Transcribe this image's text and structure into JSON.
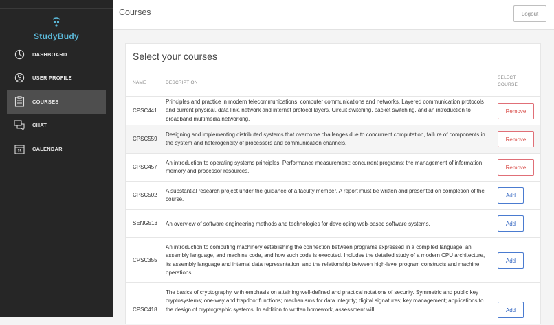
{
  "app": {
    "name": "StudyBudy"
  },
  "nav": [
    {
      "label": "DASHBOARD",
      "icon": "dashboard-icon"
    },
    {
      "label": "USER PROFILE",
      "icon": "user-profile-icon"
    },
    {
      "label": "COURSES",
      "icon": "courses-icon",
      "active": true
    },
    {
      "label": "CHAT",
      "icon": "chat-icon"
    },
    {
      "label": "CALENDAR",
      "icon": "calendar-icon"
    }
  ],
  "header": {
    "title": "Courses",
    "logout_label": "Logout"
  },
  "card": {
    "heading": "Select your courses",
    "columns": {
      "name": "NAME",
      "description": "DESCRIPTION",
      "select": "SELECT\nCOURSE"
    }
  },
  "courses": [
    {
      "name": "CPSC441",
      "description": "Principles and practice in modern telecommunications, computer communications and networks. Layered communication protocols and current physical, data link, network and internet protocol layers. Circuit switching, packet switching, and an introduction to broadband multimedia networking.",
      "action": "Remove"
    },
    {
      "name": "CPSC559",
      "description": "Designing and implementing distributed systems that overcome challenges due to concurrent computation, failure of components in the system and heterogeneity of processors and communication channels.",
      "action": "Remove"
    },
    {
      "name": "CPSC457",
      "description": "An introduction to operating systems principles. Performance measurement; concurrent programs; the management of information, memory and processor resources.",
      "action": "Remove"
    },
    {
      "name": "CPSC502",
      "description": "A substantial research project under the guidance of a faculty member. A report must be written and presented on completion of the course.",
      "action": "Add"
    },
    {
      "name": "SENG513",
      "description": "An overview of software engineering methods and technologies for developing web-based software systems.",
      "action": "Add"
    },
    {
      "name": "CPSC355",
      "description": "An introduction to computing machinery establishing the connection between programs expressed in a compiled language, an assembly language, and machine code, and how such code is executed. Includes the detailed study of a modern CPU architecture, its assembly language and internal data representation, and the relationship between high-level program constructs and machine operations.",
      "action": "Add"
    },
    {
      "name": "CPSC418",
      "description": "The basics of cryptography, with emphasis on attaining well-defined and practical notations of security. Symmetric and public key cryptosystems; one-way and trapdoor functions; mechanisms for data integrity; digital signatures; key management; applications to the design of cryptographic systems. In addition to written homework, assessment will",
      "action": "Add"
    }
  ],
  "colors": {
    "sidebar": "#262626",
    "remove": "#d9534f",
    "add": "#3a6bc4",
    "brand": "#5bb8d8"
  }
}
